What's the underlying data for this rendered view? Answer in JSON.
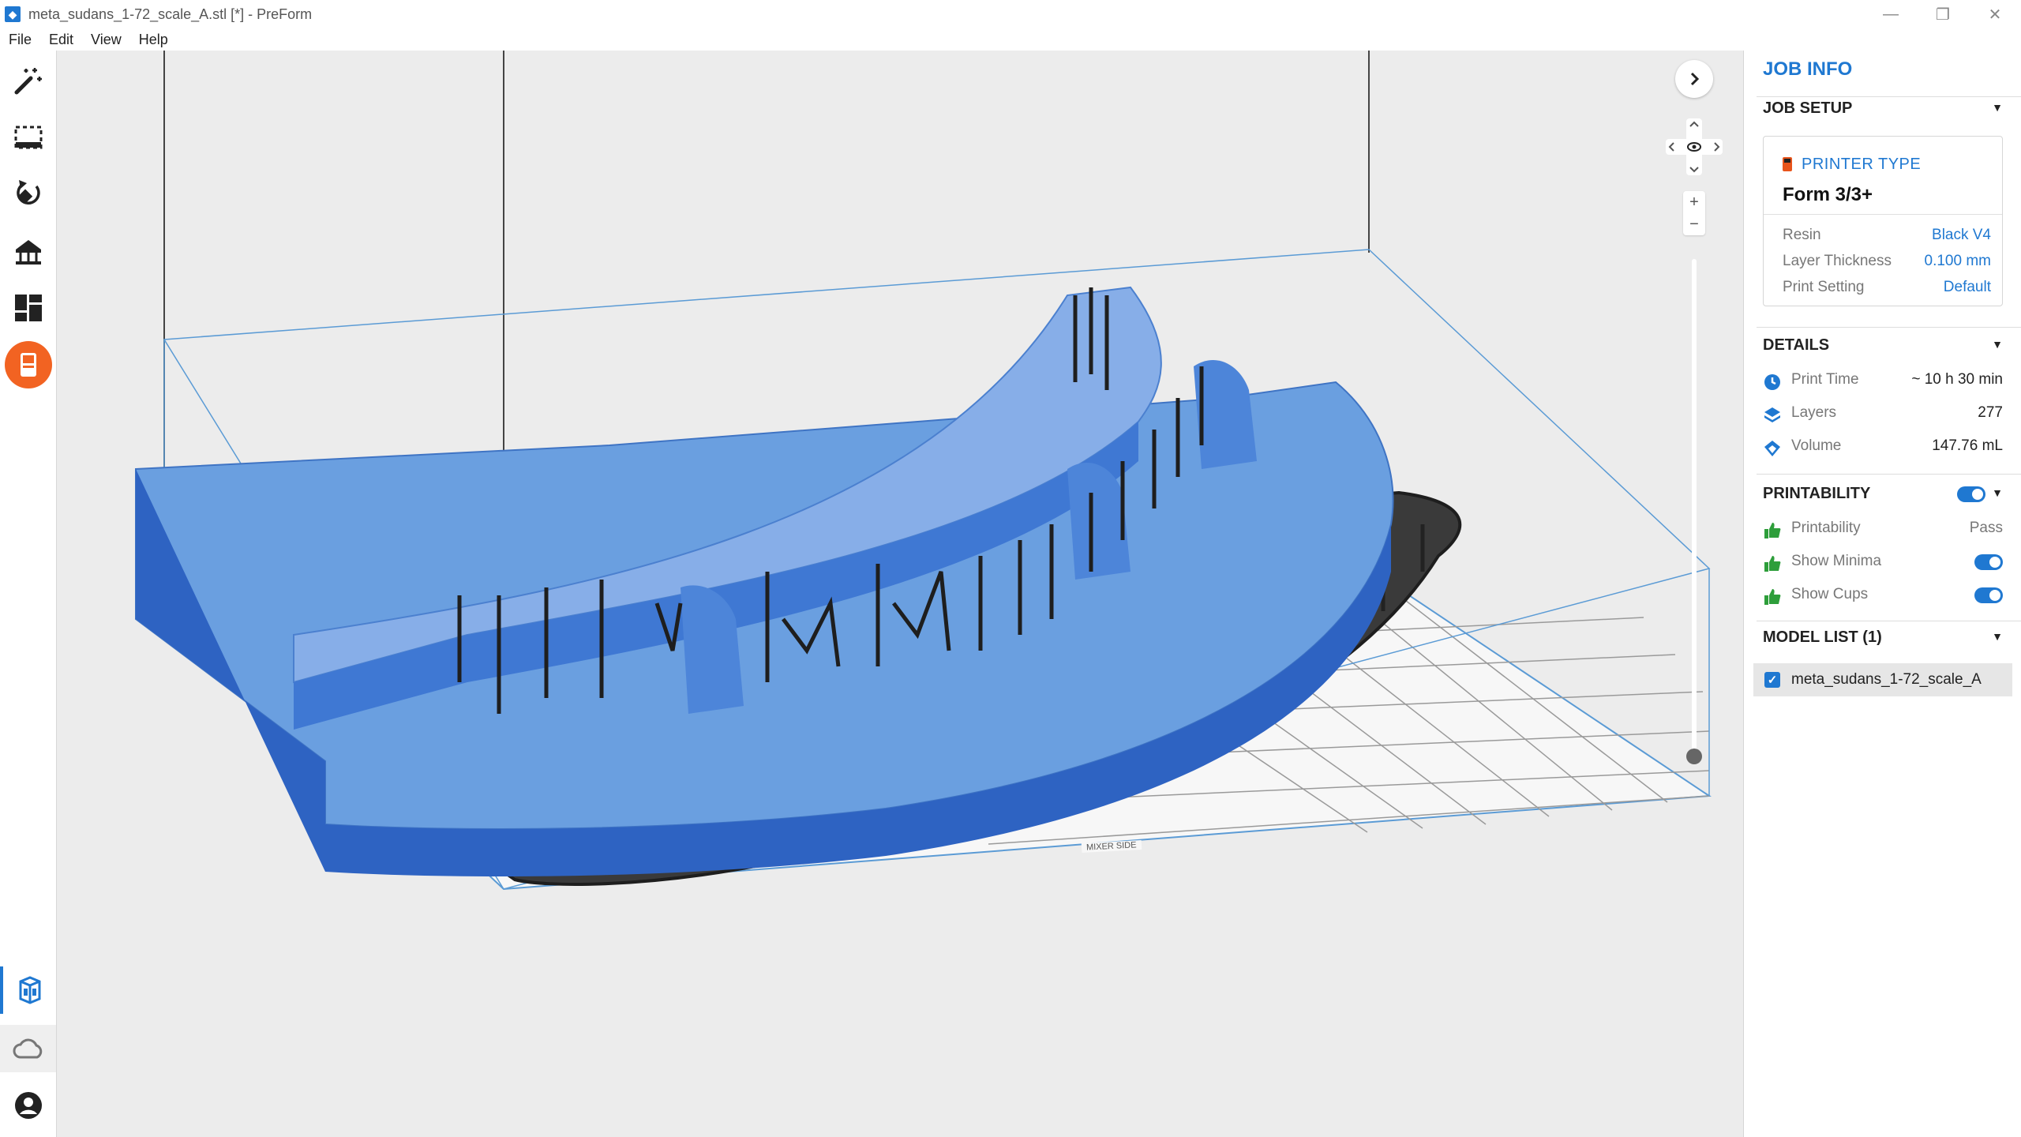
{
  "window": {
    "title": "meta_sudans_1-72_scale_A.stl [*] - PreForm",
    "controls": {
      "minimize": "—",
      "restore": "❐",
      "close": "✕"
    }
  },
  "menu": [
    "File",
    "Edit",
    "View",
    "Help"
  ],
  "left_toolbar": {
    "tools": [
      "magic-wand-icon",
      "select-box-icon",
      "orient-icon",
      "supports-icon",
      "layout-icon",
      "print-job-icon"
    ],
    "bottom": [
      "printer-view-icon",
      "cloud-icon",
      "account-icon"
    ]
  },
  "viewport": {
    "plate_labels": [
      "MIXER SIDE"
    ]
  },
  "panel": {
    "title": "JOB INFO",
    "job_setup": {
      "header": "JOB SETUP",
      "printer_type_label": "PRINTER TYPE",
      "printer_name": "Form 3/3+",
      "rows": [
        {
          "key": "Resin",
          "value": "Black V4"
        },
        {
          "key": "Layer Thickness",
          "value": "0.100 mm"
        },
        {
          "key": "Print Setting",
          "value": "Default"
        }
      ]
    },
    "details": {
      "header": "DETAILS",
      "rows": [
        {
          "icon": "clock-icon",
          "key": "Print Time",
          "value": "~ 10 h 30 min"
        },
        {
          "icon": "layers-icon",
          "key": "Layers",
          "value": "277"
        },
        {
          "icon": "volume-icon",
          "key": "Volume",
          "value": "147.76 mL"
        }
      ]
    },
    "printability": {
      "header": "PRINTABILITY",
      "rows": [
        {
          "icon": "thumbs-up-icon",
          "key": "Printability",
          "value": "Pass"
        },
        {
          "icon": "thumbs-up-icon",
          "key": "Show Minima",
          "toggle": true
        },
        {
          "icon": "thumbs-up-icon",
          "key": "Show Cups",
          "toggle": true
        }
      ]
    },
    "model_list": {
      "header": "MODEL LIST (1)",
      "items": [
        {
          "name": "meta_sudans_1-72_scale_A",
          "checked": true
        }
      ]
    }
  },
  "colors": {
    "accent": "#1f78d1",
    "active_tool": "#f26322",
    "model": "#4a86d8",
    "pass": "#2e9e3b"
  }
}
